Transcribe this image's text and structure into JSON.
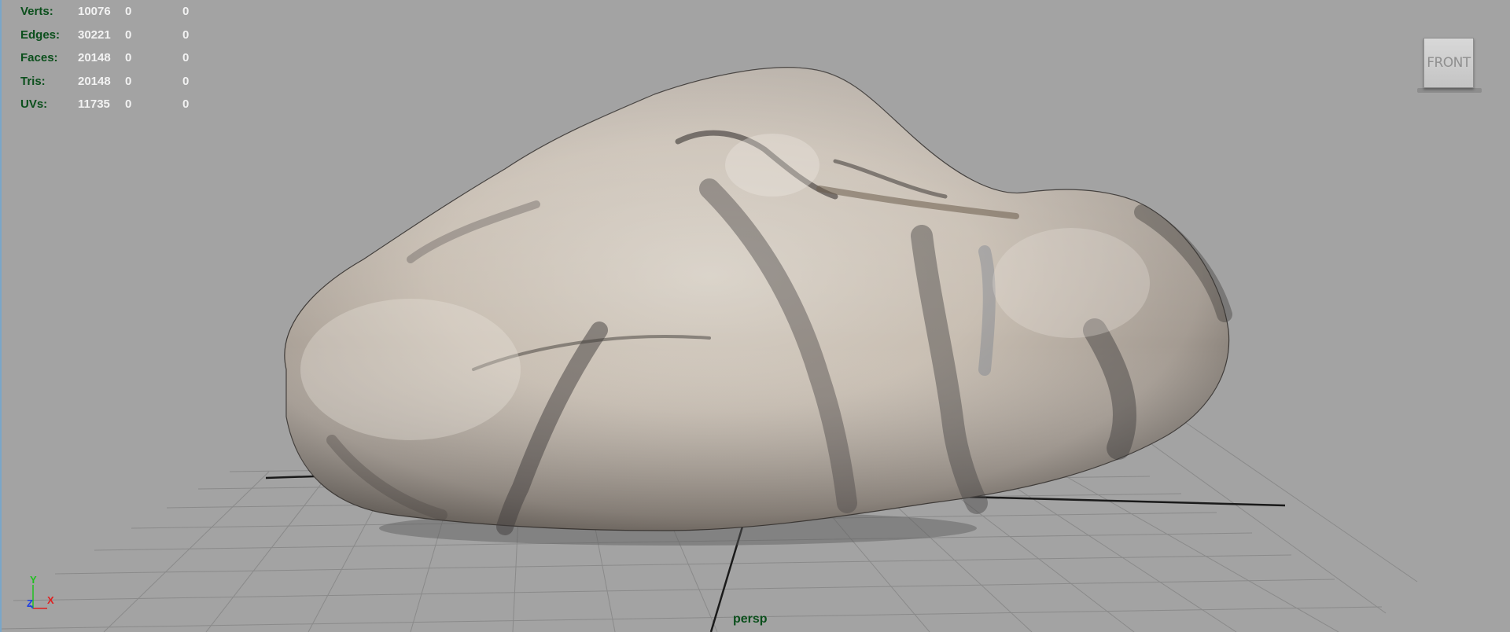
{
  "hud": {
    "rows": [
      {
        "label": "Verts:",
        "count": "10076",
        "selected": "0",
        "uv": "0"
      },
      {
        "label": "Edges:",
        "count": "30221",
        "selected": "0",
        "uv": "0"
      },
      {
        "label": "Faces:",
        "count": "20148",
        "selected": "0",
        "uv": "0"
      },
      {
        "label": "Tris:",
        "count": "20148",
        "selected": "0",
        "uv": "0"
      },
      {
        "label": "UVs:",
        "count": "11735",
        "selected": "0",
        "uv": "0"
      }
    ]
  },
  "viewcube": {
    "face_label": "FRONT"
  },
  "camera": {
    "name": "persp"
  },
  "axis_gizmo": {
    "y": "Y",
    "z": "Z",
    "x": "X"
  },
  "colors": {
    "background": "#a3a3a3",
    "hud_label": "#0b4f1c",
    "hud_value": "#f2f2f2",
    "grid": "#7d7d7d",
    "axis_x": "#e02020",
    "axis_y": "#20c020",
    "axis_z": "#2040e0"
  }
}
